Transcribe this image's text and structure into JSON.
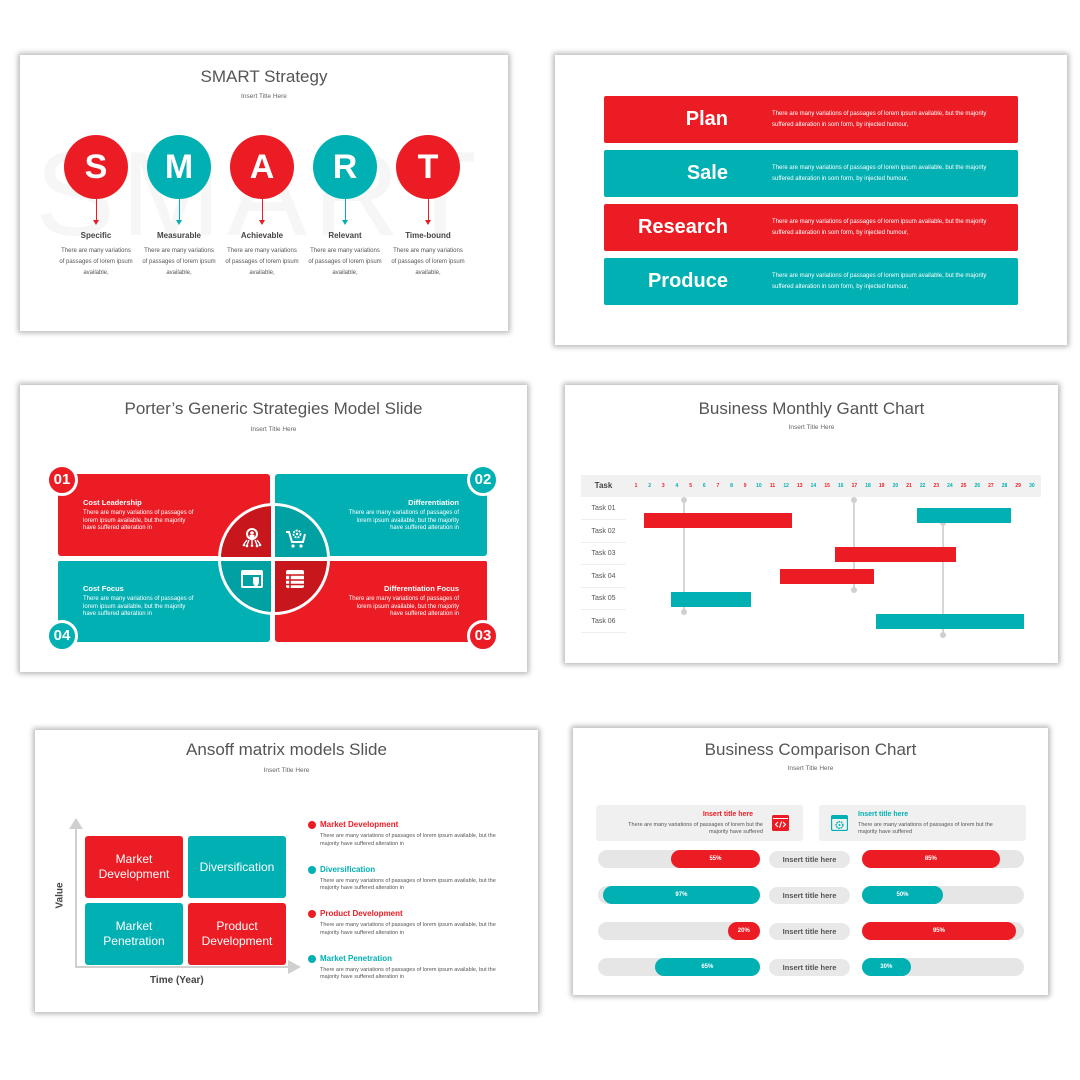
{
  "colors": {
    "red": "#ec1c24",
    "teal": "#00b0b3",
    "grey_text": "#555555",
    "track": "#e6e6e6"
  },
  "smart": {
    "title": "SMART Strategy",
    "subtitle": "Insert Title Here",
    "watermark": "SMART",
    "items": [
      {
        "letter": "S",
        "label": "Specific",
        "desc": "There are many variations of passages of lorem ipsum available,",
        "color": "red"
      },
      {
        "letter": "M",
        "label": "Measurable",
        "desc": "There are many variations of passages of lorem ipsum available,",
        "color": "teal"
      },
      {
        "letter": "A",
        "label": "Achievable",
        "desc": "There are many variations of passages of lorem ipsum available,",
        "color": "red"
      },
      {
        "letter": "R",
        "label": "Relevant",
        "desc": "There are many variations of passages of lorem ipsum available,",
        "color": "teal"
      },
      {
        "letter": "T",
        "label": "Time-bound",
        "desc": "There are many variations of passages of lorem ipsum available,",
        "color": "red"
      }
    ]
  },
  "plan": {
    "rows": [
      {
        "label": "Plan",
        "desc": "There are many variations of passages of lorem ipsum available, but the majority suffered alteration in som form, by injected humour,",
        "color": "red"
      },
      {
        "label": "Sale",
        "desc": "There are many variations of passages of lorem ipsum available, but the majority suffered alteration in som form, by injected humour,",
        "color": "teal"
      },
      {
        "label": "Research",
        "desc": "There are many variations of passages of lorem ipsum available, but the majority suffered alteration in som form, by injected humour,",
        "color": "red"
      },
      {
        "label": "Produce",
        "desc": "There are many variations of passages of lorem ipsum available, but the majority suffered alteration in som form, by injected humour,",
        "color": "teal"
      }
    ]
  },
  "porter": {
    "title": "Porter’s Generic Strategies Model Slide",
    "subtitle": "Insert Title Here",
    "quadrants": [
      {
        "num": "01",
        "head": "Cost Leadership",
        "desc": "There are many variations of passages of lorem ipsum available, but the majority have suffered alteration in",
        "color": "red",
        "icon": "user-network-icon"
      },
      {
        "num": "02",
        "head": "Differentiation",
        "desc": "There are many variations of passages of lorem ipsum available, but the majority have suffered alteration in",
        "color": "teal",
        "icon": "cart-gear-icon"
      },
      {
        "num": "03",
        "head": "Differentiation Focus",
        "desc": "There are many variations of passages of lorem ipsum available, but the majority have suffered alteration in",
        "color": "red",
        "icon": "server-list-icon"
      },
      {
        "num": "04",
        "head": "Cost Focus",
        "desc": "There are many variations of passages of lorem ipsum available, but the majority have suffered alteration in",
        "color": "teal",
        "icon": "browser-shield-icon"
      }
    ]
  },
  "gantt": {
    "title": "Business Monthly Gantt Chart",
    "subtitle": "Insert Title Here",
    "task_header": "Task",
    "rows": [
      "Task 01",
      "Task 02",
      "Task 03",
      "Task 04",
      "Task 05",
      "Task 06"
    ]
  },
  "ansoff": {
    "title": "Ansoff matrix models Slide",
    "subtitle": "Insert Title Here",
    "y_label": "Value",
    "x_label": "Time (Year)",
    "boxes": [
      {
        "label": "Market Development",
        "color": "red"
      },
      {
        "label": "Diversification",
        "color": "teal"
      },
      {
        "label": "Market Penetration",
        "color": "teal"
      },
      {
        "label": "Product Development",
        "color": "red"
      }
    ],
    "legend": [
      {
        "head": "Market Development",
        "desc": "There are many variations of passages of lorem ipsum available, but the majority have suffered alteration in",
        "color": "red"
      },
      {
        "head": "Diversification",
        "desc": "There are many variations of passages of lorem ipsum available, but the majority have suffered alteration in",
        "color": "teal"
      },
      {
        "head": "Product Development",
        "desc": "There are many variations of passages of lorem ipsum available, but the majority have suffered alteration in",
        "color": "red"
      },
      {
        "head": "Market Penetration",
        "desc": "There are many variations of passages of lorem ipsum available, but the majority have suffered alteration in",
        "color": "teal"
      }
    ]
  },
  "compare": {
    "title": "Business Comparison Chart",
    "subtitle": "Insert Title Here",
    "left_card": {
      "title": "Insert title here",
      "desc": "There are many variations of passages of lorem but the majority have suffered",
      "icon": "code-window-icon"
    },
    "right_card": {
      "title": "Insert title here",
      "desc": "There are many variations of passages of lorem but the majority have suffered",
      "icon": "settings-window-icon"
    },
    "mid_label": "Insert title here"
  },
  "chart_data": [
    {
      "type": "gantt",
      "title": "Business Monthly Gantt Chart",
      "subtitle": "Insert Title Here",
      "x_ticks": [
        1,
        2,
        3,
        4,
        5,
        6,
        7,
        8,
        9,
        10,
        11,
        12,
        13,
        14,
        15,
        16,
        17,
        18,
        19,
        20,
        21,
        22,
        23,
        24,
        25,
        26,
        27,
        28,
        29,
        30
      ],
      "xlim": [
        1,
        30
      ],
      "categories": [
        "Task 01",
        "Task 02",
        "Task 03",
        "Task 04",
        "Task 05",
        "Task 06"
      ],
      "bars": [
        {
          "row": 1.5,
          "start": 2,
          "end": 12,
          "color": "red"
        },
        {
          "row": 1.3,
          "start": 22,
          "end": 28,
          "color": "teal"
        },
        {
          "row": 3,
          "start": 16,
          "end": 24,
          "color": "red"
        },
        {
          "row": 4,
          "start": 12,
          "end": 18,
          "color": "red"
        },
        {
          "row": 5,
          "start": 4,
          "end": 9,
          "color": "teal"
        },
        {
          "row": 6,
          "start": 19,
          "end": 29,
          "color": "teal"
        }
      ],
      "milestones": [
        {
          "day": 4.5,
          "from_row": 1,
          "to_row": 5.5
        },
        {
          "day": 17,
          "from_row": 1,
          "to_row": 4.5
        },
        {
          "day": 23.5,
          "from_row": 2,
          "to_row": 6.5
        }
      ]
    },
    {
      "type": "bar",
      "title": "Business Comparison Chart",
      "categories": [
        "Insert title here",
        "Insert title here",
        "Insert title here",
        "Insert title here"
      ],
      "series": [
        {
          "name": "Left",
          "values": [
            55,
            97,
            20,
            65
          ],
          "colors": [
            "red",
            "teal",
            "red",
            "teal"
          ]
        },
        {
          "name": "Right",
          "values": [
            85,
            50,
            95,
            30
          ],
          "colors": [
            "red",
            "teal",
            "red",
            "teal"
          ]
        }
      ],
      "ylim": [
        0,
        100
      ]
    }
  ]
}
